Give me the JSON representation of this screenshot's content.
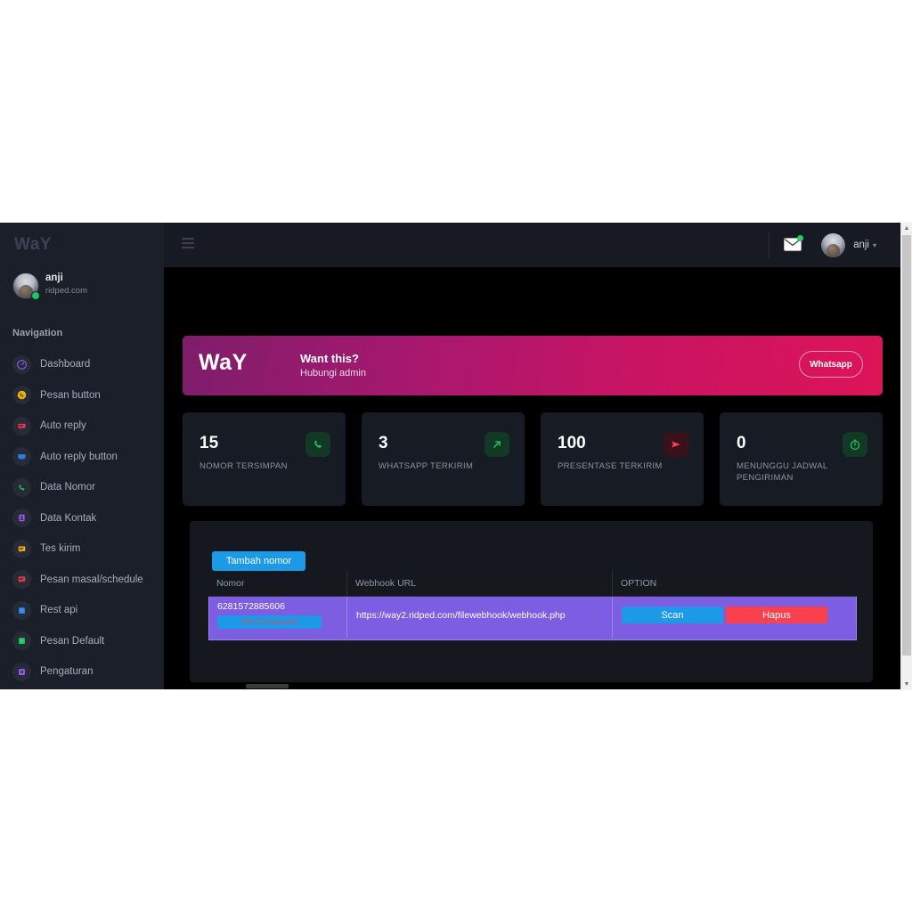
{
  "app": {
    "brand": "WaY"
  },
  "sidebar": {
    "profile": {
      "name": "anji",
      "domain": "ridped.com"
    },
    "nav_heading": "Navigation",
    "items": [
      {
        "label": "Dashboard",
        "icon": "dashboard-icon",
        "color": "#8b5cf6"
      },
      {
        "label": "Pesan button",
        "icon": "whatsapp-icon",
        "color": "#e8b008"
      },
      {
        "label": "Auto reply",
        "icon": "chat-lines-icon",
        "color": "#e8394b"
      },
      {
        "label": "Auto reply button",
        "icon": "monitor-icon",
        "color": "#2f7de0"
      },
      {
        "label": "Data Nomor",
        "icon": "phone-icon",
        "color": "#1fbf5b"
      },
      {
        "label": "Data Kontak",
        "icon": "contact-card-icon",
        "color": "#9d5cf0"
      },
      {
        "label": "Tes kirim",
        "icon": "chat-bubble-icon",
        "color": "#e8b008"
      },
      {
        "label": "Pesan masal/schedule",
        "icon": "chat-bubble-alt-icon",
        "color": "#e8394b"
      },
      {
        "label": "Rest api",
        "icon": "square-api-icon",
        "color": "#2f7de0"
      },
      {
        "label": "Pesan Default",
        "icon": "square-default-icon",
        "color": "#1fbf5b"
      },
      {
        "label": "Pengaturan",
        "icon": "gear-icon",
        "color": "#9d5cf0"
      }
    ]
  },
  "header": {
    "menu_toggle": "hamburger-icon",
    "mail_icon": "envelope-icon",
    "user": "anji",
    "caret": "▾"
  },
  "banner": {
    "logo": "WaY",
    "title": "Want this?",
    "subtitle": "Hubungi admin",
    "button": "Whatsapp"
  },
  "stats": [
    {
      "value": "15",
      "label": "NOMOR TERSIMPAN",
      "icon": "phone-icon",
      "icon_bg": "#123826",
      "icon_color": "#1fbf5b"
    },
    {
      "value": "3",
      "label": "WHATSAPP TERKIRIM",
      "icon": "arrow-up-right-icon",
      "icon_bg": "#123826",
      "icon_color": "#1fbf5b"
    },
    {
      "value": "100",
      "label": "PRESENTASE TERKIRIM",
      "icon": "send-icon",
      "icon_bg": "#3a1118",
      "icon_color": "#f8414c"
    },
    {
      "value": "0",
      "label": "MENUNGGU JADWAL PENGIRIMAN",
      "icon": "timer-icon",
      "icon_bg": "#123826",
      "icon_color": "#1fbf5b"
    }
  ],
  "panel": {
    "add_button": "Tambah nomor",
    "columns": [
      "Nomor",
      "Webhook URL",
      "OPTION"
    ],
    "rows": [
      {
        "nomor": "6281572885606",
        "status": "Not Connected",
        "webhook_url": "https://way2.ridped.com/filewebhook/webhook.php",
        "scan_label": "Scan",
        "delete_label": "Hapus"
      }
    ]
  },
  "scroll": {
    "up_arrow": "▲",
    "down_arrow": "▼"
  }
}
